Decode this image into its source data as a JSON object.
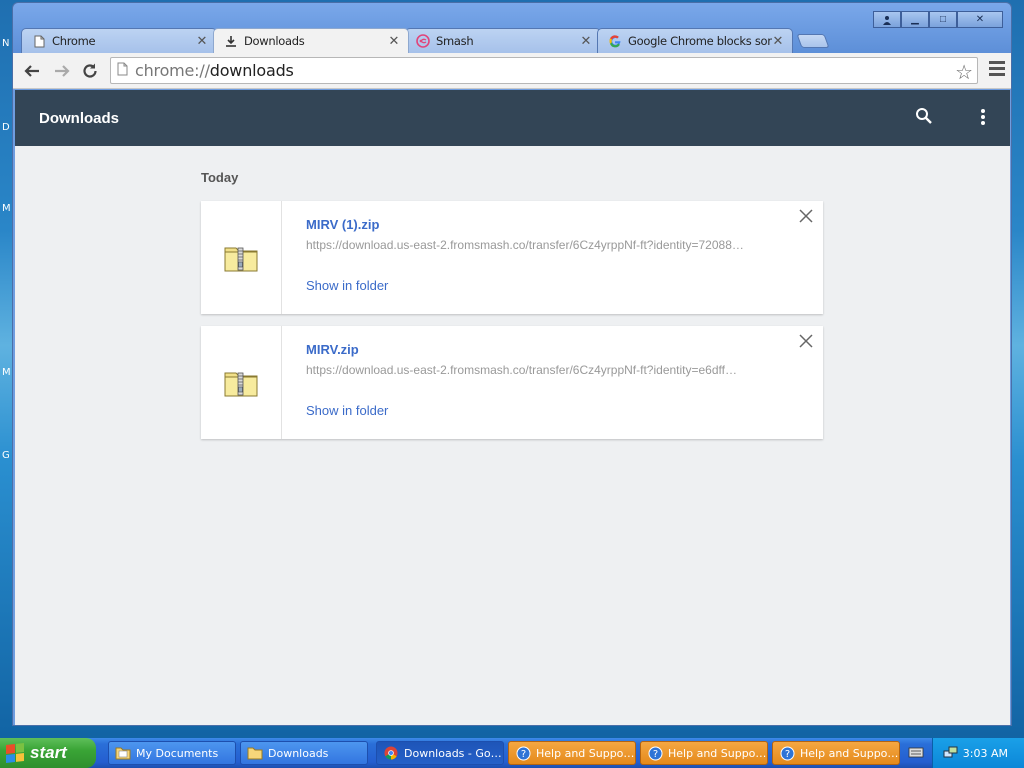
{
  "desktop": {
    "side_letters": [
      "N",
      "D",
      "M",
      "M",
      "G"
    ]
  },
  "window": {
    "tabs": [
      {
        "title": "Chrome",
        "icon": "page-icon",
        "active": false
      },
      {
        "title": "Downloads",
        "icon": "download-icon",
        "active": true
      },
      {
        "title": "Smash",
        "icon": "smash-icon",
        "active": false
      },
      {
        "title": "Google Chrome blocks some",
        "icon": "google-icon",
        "active": false
      }
    ],
    "controls": {
      "minimize": "▁",
      "restore": "□",
      "close": "✕"
    }
  },
  "toolbar": {
    "url_scheme": "chrome://",
    "url_path": "downloads"
  },
  "downloads": {
    "header_title": "Downloads",
    "section_label": "Today",
    "items": [
      {
        "filename": "MIRV (1).zip",
        "url": "https://download.us-east-2.fromsmash.co/transfer/6Cz4yrppNf-ft?identity=72088…",
        "action": "Show in folder"
      },
      {
        "filename": "MIRV.zip",
        "url": "https://download.us-east-2.fromsmash.co/transfer/6Cz4yrppNf-ft?identity=e6dff…",
        "action": "Show in folder"
      }
    ]
  },
  "taskbar": {
    "start_label": "start",
    "tasks": [
      {
        "label": "My Documents",
        "icon": "folder-icon",
        "style": "normal"
      },
      {
        "label": "Downloads",
        "icon": "folder-icon",
        "style": "normal"
      },
      {
        "label": "Downloads - Go…",
        "icon": "chrome-icon",
        "style": "active"
      },
      {
        "label": "Help and Suppo…",
        "icon": "help-icon",
        "style": "orange"
      },
      {
        "label": "Help and Suppo…",
        "icon": "help-icon",
        "style": "orange"
      },
      {
        "label": "Help and Suppo…",
        "icon": "help-icon",
        "style": "orange"
      }
    ],
    "clock": "3:03 AM"
  }
}
